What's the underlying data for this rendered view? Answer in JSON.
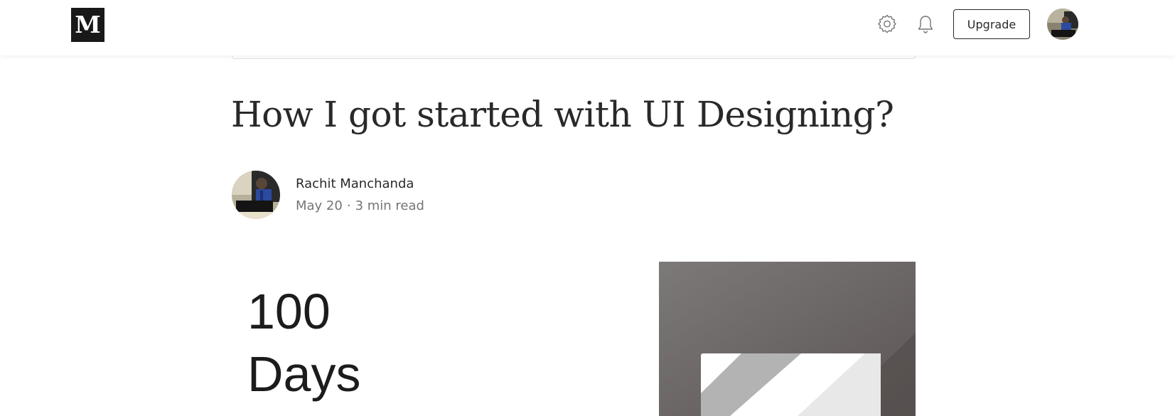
{
  "header": {
    "logo_text": "M",
    "upgrade_label": "Upgrade",
    "icons": [
      "gear-icon",
      "bell-icon"
    ]
  },
  "article": {
    "title": "How I got started with UI Designing?",
    "author": "Rachit Manchanda",
    "date": "May 20",
    "separator": "·",
    "read_time": "3 min read"
  },
  "hero": {
    "line1": "100",
    "line2": "Days"
  },
  "colors": {
    "text_primary": "#292929",
    "text_secondary": "#757575",
    "logo_bg": "#191919",
    "hero_art_bg": "#6f6a69"
  }
}
